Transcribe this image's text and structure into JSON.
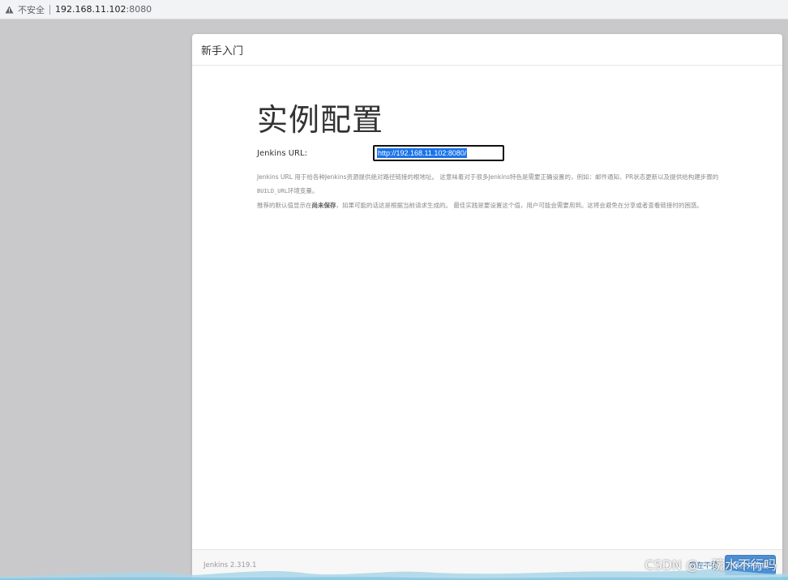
{
  "browser": {
    "security_label": "不安全",
    "url_host": "192.168.11.102",
    "url_port": ":8080"
  },
  "dialog": {
    "header_title": "新手入门",
    "page_title": "实例配置",
    "url_label": "Jenkins URL:",
    "url_value": "http://192.168.11.102:8080/",
    "help_line1_a": "Jenkins URL 用于给各种Jenkins资源提供绝对路径链接的根地址。 这意味着对于很多Jenkins特色是需要正确设置的，例如：邮件通知、PR状态更新以及提供给构建步骤的",
    "help_line1_code": "BUILD_URL",
    "help_line1_b": "环境变量。",
    "help_line2_a": "推荐的默认值显示在",
    "help_line2_bold": "尚未保存",
    "help_line2_b": "，如果可能的话这是根据当前请求生成的。 最佳实践是要设置这个值，用户可能会需要用到。这将会避免在分享或者查看链接时的困惑。"
  },
  "footer": {
    "version": "Jenkins 2.319.1",
    "later_label": "现在不要",
    "save_label": "保存并完成"
  },
  "watermark": "CSDN @一碗水不行吗",
  "icons": {
    "warning": "warning-triangle-icon"
  },
  "colors": {
    "selection": "#1a73e8",
    "primary_button": "#4a90d9"
  }
}
